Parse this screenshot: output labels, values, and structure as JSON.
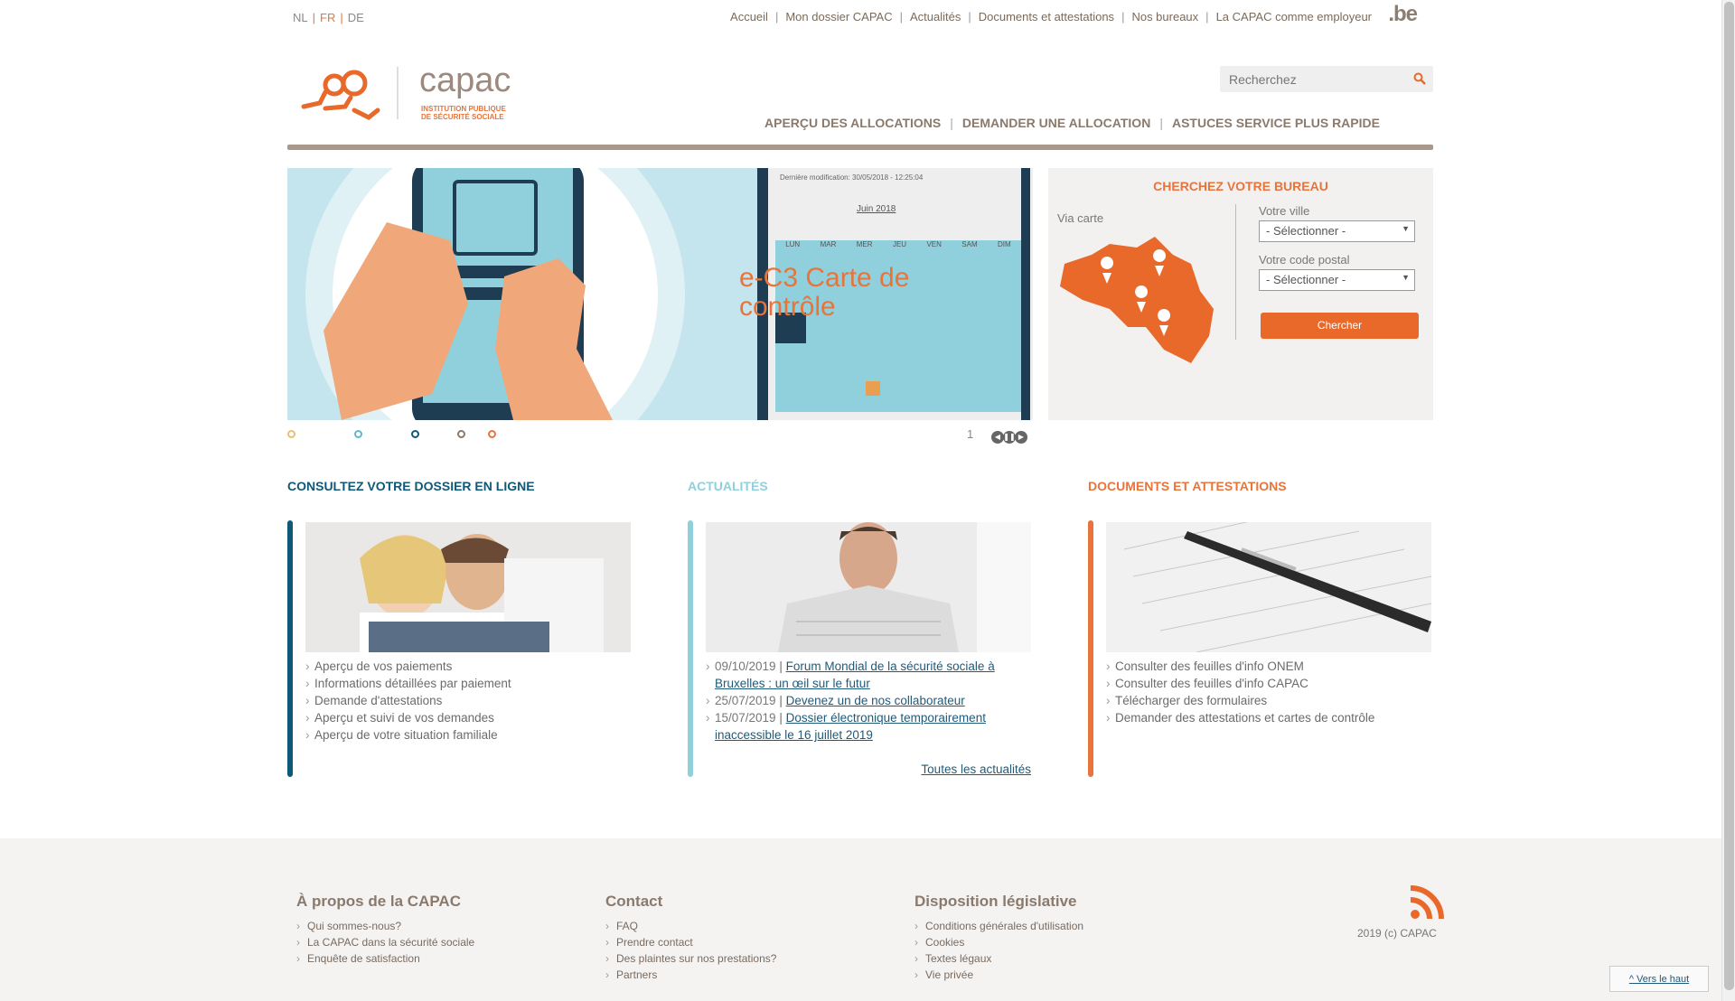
{
  "lang": {
    "nl": "NL",
    "fr": "FR",
    "de": "DE"
  },
  "topnav": [
    "Accueil",
    "Mon dossier CAPAC",
    "Actualités",
    "Documents et attestations",
    "Nos bureaux",
    "La CAPAC comme employeur"
  ],
  "be_logo": ".be",
  "logo": {
    "word": "capac",
    "sub1": "INSTITUTION PUBLIQUE",
    "sub2": "DE SÉCURITÉ SOCIALE"
  },
  "search": {
    "placeholder": "Recherchez"
  },
  "mainnav": [
    "APERÇU DES ALLOCATIONS",
    "DEMANDER UNE ALLOCATION",
    "ASTUCES SERVICE PLUS RAPIDE"
  ],
  "slider": {
    "caption": "e-C3 Carte de contrôle",
    "page": "1",
    "calendar_title": "Juin 2018",
    "calendar_days": [
      "LUN",
      "MAR",
      "MER",
      "JEU",
      "VEN",
      "SAM",
      "DIM"
    ]
  },
  "bureau": {
    "title": "CHERCHEZ VOTRE BUREAU",
    "via": "Via carte",
    "ville_label": "Votre ville",
    "ville_value": "- Sélectionner -",
    "cp_label": "Votre code postal",
    "cp_value": "- Sélectionner -",
    "button": "Chercher"
  },
  "col1": {
    "title": "CONSULTEZ VOTRE DOSSIER EN LIGNE",
    "links": [
      "Aperçu de vos paiements",
      "Informations détaillées par paiement",
      "Demande d'attestations",
      "Aperçu et suivi de vos demandes",
      "Aperçu de votre situation familiale"
    ]
  },
  "col2": {
    "title": "ACTUALITÉS",
    "news": [
      {
        "date": "09/10/2019",
        "title": "Forum Mondial de la sécurité sociale à Bruxelles : un œil sur le futur"
      },
      {
        "date": "25/07/2019",
        "title": "Devenez un de nos collaborateur"
      },
      {
        "date": "15/07/2019",
        "title": "Dossier électronique temporairement inaccessible le 16 juillet 2019"
      }
    ],
    "all": "Toutes les actualités"
  },
  "col3": {
    "title": "DOCUMENTS ET ATTESTATIONS",
    "links": [
      "Consulter des feuilles d'info ONEM",
      "Consulter des feuilles d'info CAPAC",
      "Télécharger des formulaires",
      "Demander des attestations et cartes de contrôle"
    ]
  },
  "footer": {
    "about": {
      "title": "À propos de la CAPAC",
      "links": [
        "Qui sommes-nous?",
        "La CAPAC dans la sécurité sociale",
        "Enquête de satisfaction"
      ]
    },
    "contact": {
      "title": "Contact",
      "links": [
        "FAQ",
        "Prendre contact",
        "Des plaintes sur nos prestations?",
        "Partners"
      ]
    },
    "legal": {
      "title": "Disposition législative",
      "links": [
        "Conditions générales d'utilisation",
        "Cookies",
        "Textes légaux",
        "Vie privée"
      ]
    },
    "copyright": "2019 (c) CAPAC",
    "top": "^ Vers le haut"
  },
  "colors": {
    "orange": "#e8743b",
    "teal": "#0e5878",
    "lightblue": "#8fd0dc",
    "brown": "#8a7a6d"
  }
}
